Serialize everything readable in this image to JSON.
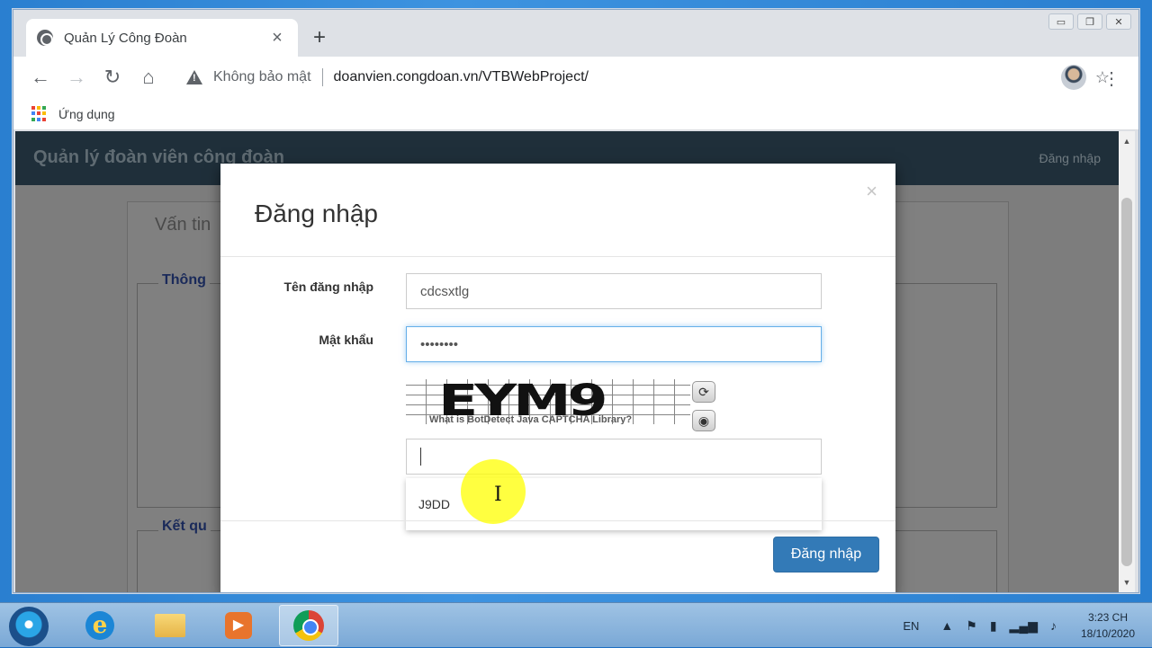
{
  "browser": {
    "tab_title": "Quản Lý Công Đoàn",
    "tab_close": "×",
    "new_tab": "+",
    "security_label": "Không bảo mật",
    "url": "doanvien.congdoan.vn/VTBWebProject/",
    "bookmark_label": "Ứng dụng",
    "window_controls": [
      "▭",
      "❐",
      "✕"
    ]
  },
  "page": {
    "brand": "Quản lý đoàn viên công đoàn",
    "nav_login": "Đăng nhập",
    "card_title": "Vấn tin",
    "panel1_title": "Thông",
    "panel2_title": "Kết qu"
  },
  "modal": {
    "title": "Đăng nhập",
    "close": "×",
    "username_label": "Tên đăng nhập",
    "username_value": "cdcsxtlg",
    "password_label": "Mật khẩu",
    "password_value": "••••••••",
    "captcha_text": "EYM9",
    "captcha_caption": "What is BotDetect Java CAPTCHA Library?",
    "captcha_refresh": "⟳",
    "captcha_audio": "◉",
    "autocomplete_suggestion": "J9DD",
    "submit_label": "Đăng nhập"
  },
  "taskbar": {
    "language": "EN",
    "time": "3:23 CH",
    "date": "18/10/2020"
  },
  "colors": {
    "primary_button": "#337ab7",
    "navbar": "#1f2f3a",
    "overlay_page": "#7d7d7d"
  }
}
